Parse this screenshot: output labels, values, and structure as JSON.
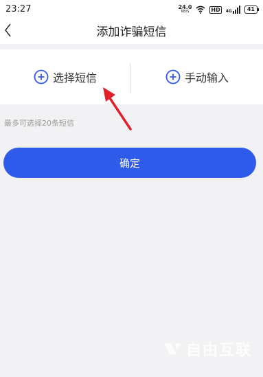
{
  "status_bar": {
    "time": "23:27",
    "net_speed": "24.0",
    "net_unit": "KB/S",
    "hd_label": "HD",
    "network_gen": "4G",
    "battery": "41"
  },
  "header": {
    "title": "添加诈骗短信"
  },
  "options": {
    "select_sms": "选择短信",
    "manual_input": "手动输入"
  },
  "hint": "最多可选择20条短信",
  "confirm_label": "确定",
  "watermark": "自由互联",
  "colors": {
    "accent": "#2f5bea",
    "arrow": "#e0202a",
    "background": "#f2f2f4"
  }
}
